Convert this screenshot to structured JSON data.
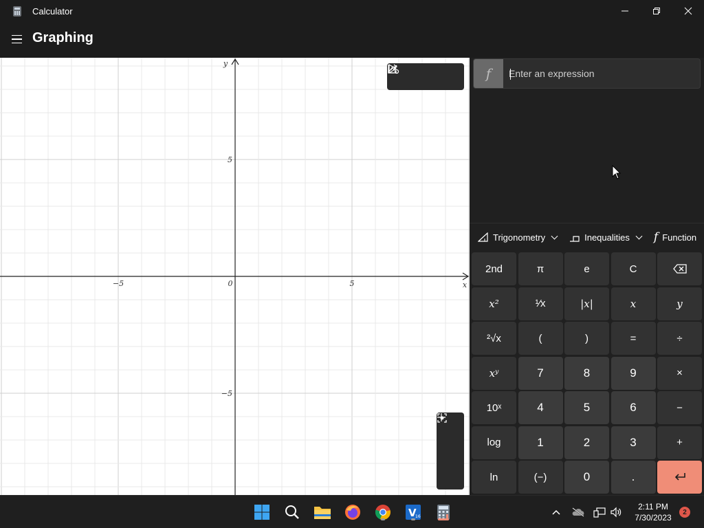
{
  "window": {
    "title": "Calculator"
  },
  "header": {
    "mode": "Graphing"
  },
  "graph": {
    "x_label": "x",
    "y_label": "y",
    "x_ticks": [
      "−5",
      "0",
      "5"
    ],
    "y_ticks": [
      "5",
      "−5"
    ]
  },
  "expression": {
    "f_label": "f",
    "placeholder": "Enter an expression",
    "value": ""
  },
  "keyboard": {
    "tabs": [
      {
        "label": "Trigonometry",
        "icon": "triangle-ruler-icon"
      },
      {
        "label": "Inequalities",
        "icon": "inequality-icon"
      },
      {
        "label": "Function",
        "icon": "function-icon"
      }
    ],
    "keys": [
      [
        "2nd",
        "π",
        "e",
        "C",
        "backspace"
      ],
      [
        "x²",
        "¹⁄x",
        "|x|",
        "x",
        "y"
      ],
      [
        "²√x",
        "(",
        ")",
        "=",
        "÷"
      ],
      [
        "xʸ",
        "7",
        "8",
        "9",
        "×"
      ],
      [
        "10ˣ",
        "4",
        "5",
        "6",
        "−"
      ],
      [
        "log",
        "1",
        "2",
        "3",
        "+"
      ],
      [
        "ln",
        "(−)",
        "0",
        ".",
        "enter"
      ]
    ]
  },
  "taskbar": {
    "time": "2:11 PM",
    "date": "7/30/2023",
    "notification_count": "2"
  },
  "colors": {
    "accent": "#f08d77",
    "panel": "#202020",
    "key_fn": "#323232",
    "key_num": "#3b3b3b"
  }
}
